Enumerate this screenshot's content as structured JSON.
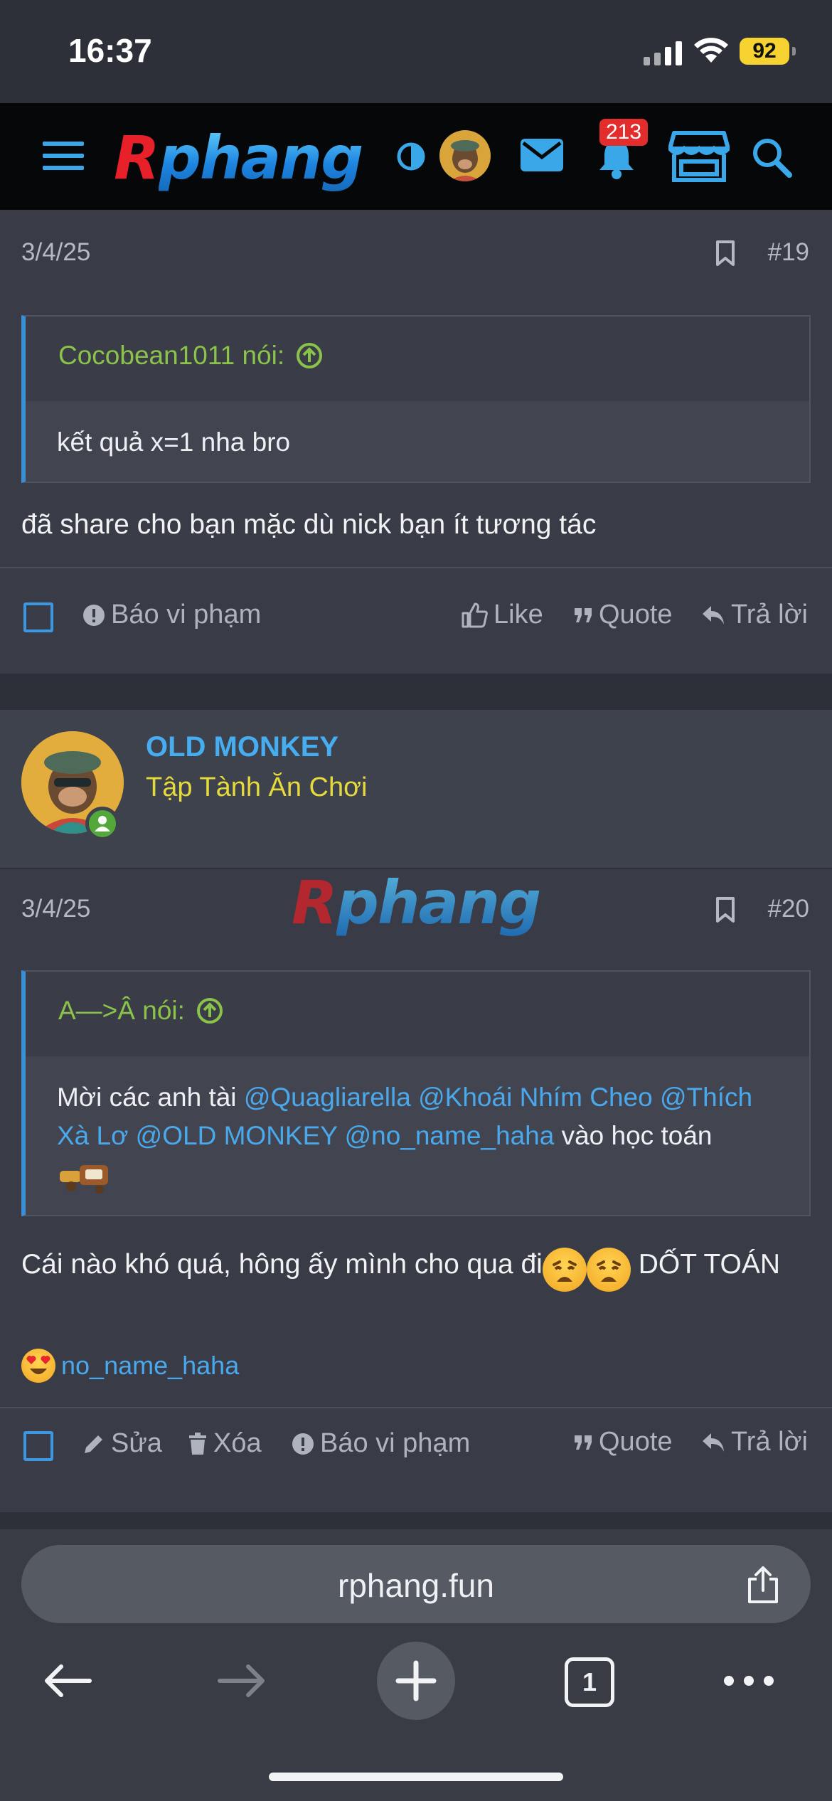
{
  "status_bar": {
    "time": "16:37",
    "battery": "92"
  },
  "nav": {
    "logo_r": "R",
    "logo_rest": "phang",
    "notification_count": "213"
  },
  "posts": [
    {
      "date": "3/4/25",
      "number": "#19",
      "quote_author": "Cocobean1011 nói:",
      "quote_text": "kết quả x=1 nha bro",
      "body": "đã share cho bạn mặc dù nick bạn ít tương tác",
      "actions": {
        "report": "Báo vi phạm",
        "like": "Like",
        "quote": "Quote",
        "reply": "Trả lời"
      }
    },
    {
      "author": {
        "name": "OLD MONKEY",
        "title": "Tập Tành Ăn Chơi"
      },
      "date": "3/4/25",
      "number": "#20",
      "quote_author": "A—>Â nói:",
      "quote_text_1": "Mời các anh tài ",
      "mentions": [
        "@Quagliarella",
        "@Khoái Nhím Cheo",
        "@Thích Xà Lơ",
        "@OLD MONKEY",
        "@no_name_haha"
      ],
      "quote_text_2": " vào học toán",
      "body_1": "Cái nào khó quá, hông ấy mình cho qua đi",
      "body_2": " DỐT TOÁN",
      "reaction_user": "no_name_haha",
      "actions": {
        "edit": "Sửa",
        "delete": "Xóa",
        "report": "Báo vi phạm",
        "quote": "Quote",
        "reply": "Trả lời"
      }
    }
  ],
  "watermark": {
    "r": "R",
    "rest": "phang"
  },
  "browser": {
    "url": "rphang.fun",
    "tab_count": "1"
  },
  "colors": {
    "accent": "#3b97e0",
    "quote_author": "#8bc34a",
    "user_title": "#e5d93b",
    "badge": "#e32d2d"
  }
}
